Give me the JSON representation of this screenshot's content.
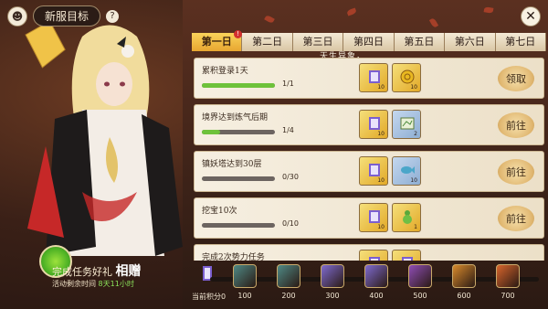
{
  "header": {
    "title": "新服目标",
    "help_icon": "question-icon",
    "left_icon": "character-head-icon",
    "close_icon": "close-icon",
    "close_glyph": "✕"
  },
  "tabs": [
    {
      "label": "第一日",
      "active": true
    },
    {
      "label": "第二日",
      "active": false
    },
    {
      "label": "第三日",
      "active": false
    },
    {
      "label": "第四日",
      "active": false
    },
    {
      "label": "第五日",
      "active": false
    },
    {
      "label": "第六日",
      "active": false
    },
    {
      "label": "第七日",
      "active": false
    }
  ],
  "tab_badge": "!",
  "subtitle": "天生异象，",
  "tasks": [
    {
      "name": "累积登录1天",
      "progress_text": "1/1",
      "progress": 1.0,
      "rewards": [
        {
          "icon": "scroll-icon",
          "count": "10",
          "style": "gold"
        },
        {
          "icon": "coin-icon",
          "count": "10",
          "style": "gold"
        }
      ],
      "button": "领取"
    },
    {
      "name": "境界达到炼气后期",
      "progress_text": "1/4",
      "progress": 0.25,
      "rewards": [
        {
          "icon": "scroll-icon",
          "count": "10",
          "style": "gold"
        },
        {
          "icon": "map-icon",
          "count": "2",
          "style": "blue"
        }
      ],
      "button": "前往"
    },
    {
      "name": "镇妖塔达到30层",
      "progress_text": "0/30",
      "progress": 0,
      "rewards": [
        {
          "icon": "scroll-icon",
          "count": "10",
          "style": "gold"
        },
        {
          "icon": "fish-icon",
          "count": "10",
          "style": "blue"
        }
      ],
      "button": "前往"
    },
    {
      "name": "挖宝10次",
      "progress_text": "0/10",
      "progress": 0,
      "rewards": [
        {
          "icon": "scroll-icon",
          "count": "10",
          "style": "gold"
        },
        {
          "icon": "gourd-icon",
          "count": "1",
          "style": "gold"
        }
      ],
      "button": "前往"
    },
    {
      "name": "完成2次势力任务",
      "progress_text": "",
      "progress": 0,
      "rewards": [
        {
          "icon": "scroll-icon",
          "count": "",
          "style": "gold"
        },
        {
          "icon": "scroll-icon",
          "count": "",
          "style": "gold"
        }
      ],
      "button": ""
    }
  ],
  "banner": {
    "line1_prefix": "完成任务好礼",
    "line1_strong": "相赠",
    "line2_prefix": "活动剩余时间 ",
    "time": "8天11小时"
  },
  "milestones": {
    "score_label": "当前积分0",
    "items": [
      {
        "value": "100",
        "color": "#4f8a86"
      },
      {
        "value": "200",
        "color": "#4f8a86"
      },
      {
        "value": "300",
        "color": "#7f6bd1"
      },
      {
        "value": "400",
        "color": "#7f6bd1"
      },
      {
        "value": "500",
        "color": "#8f4db5"
      },
      {
        "value": "600",
        "color": "#d88a2c"
      },
      {
        "value": "700",
        "color": "#d8652c"
      }
    ]
  }
}
